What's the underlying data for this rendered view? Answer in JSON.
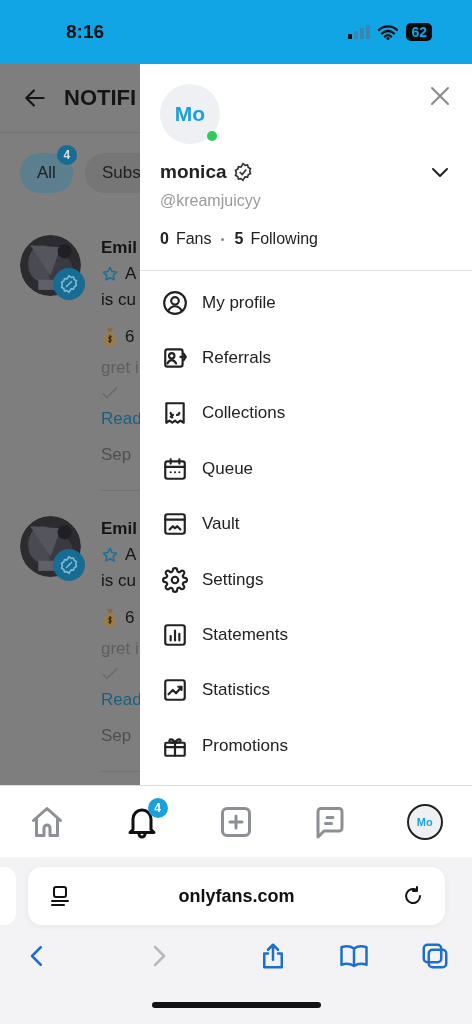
{
  "status_bar": {
    "time": "8:16",
    "battery": "62"
  },
  "page": {
    "title": "NOTIFI",
    "filters": [
      {
        "label": "All",
        "badge": "4",
        "selected": true
      },
      {
        "label": "Subs",
        "selected": false
      }
    ],
    "notifications": [
      {
        "name": "Emil",
        "line_1": "A",
        "line_2": "is cu",
        "amount": "6",
        "line_4": "gret i",
        "link": "Read",
        "date": "Sep"
      },
      {
        "name": "Emil",
        "line_1": "A",
        "line_2": "is cu",
        "amount": "6",
        "line_4": "gret i",
        "link": "Read",
        "date": "Sep"
      }
    ]
  },
  "drawer": {
    "avatar": "Mo",
    "online": true,
    "name": "monica",
    "verified": true,
    "handle": "@kreamjuicyy",
    "fans_count": "0",
    "fans_label": "Fans",
    "following_count": "5",
    "following_label": "Following",
    "menu": [
      {
        "kind": "profile",
        "label": "My profile"
      },
      {
        "kind": "referrals",
        "label": "Referrals"
      },
      {
        "kind": "collections",
        "label": "Collections"
      },
      {
        "kind": "queue",
        "label": "Queue"
      },
      {
        "kind": "vault",
        "label": "Vault"
      },
      {
        "kind": "settings",
        "label": "Settings"
      },
      {
        "kind": "statements",
        "label": "Statements"
      },
      {
        "kind": "statistics",
        "label": "Statistics"
      },
      {
        "kind": "promotions",
        "label": "Promotions"
      }
    ]
  },
  "tab_bar": [
    {
      "kind": "home",
      "selected": false
    },
    {
      "kind": "notifications",
      "badge": "4",
      "selected": true
    },
    {
      "kind": "add",
      "selected": false
    },
    {
      "kind": "messages",
      "selected": false
    },
    {
      "kind": "avatar",
      "label": "Mo",
      "selected": false
    }
  ],
  "browser": {
    "url": "onlyfans.com",
    "forward_disabled": true
  }
}
